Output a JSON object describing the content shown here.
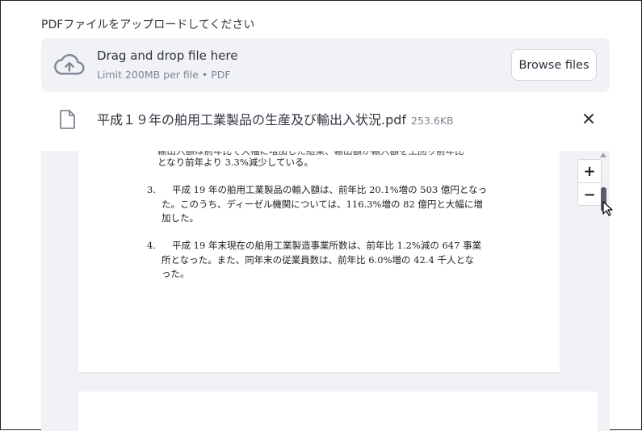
{
  "uploader": {
    "label": "PDFファイルをアップロードしてください",
    "dropzone_title": "Drag and drop file here",
    "dropzone_limit": "Limit 200MB per file • PDF",
    "browse_label": "Browse files"
  },
  "file": {
    "name": "平成１９年の舶用工業製品の生産及び輸出入状況.pdf",
    "size": "253.6KB"
  },
  "pdf": {
    "clipped_line": "輸出入額は前年比で大幅に増加した結果、輸出額が輸入額を上回り前年比",
    "lines": [
      {
        "num": "",
        "text": "となり前年より 3.3%減少している。"
      },
      {
        "num": "3.",
        "text": "平成 19 年の舶用工業製品の輸入額は、前年比 20.1%増の 503 億円となっ"
      },
      {
        "num": "",
        "text": "た。このうち、ディーゼル機関については、116.3%増の 82 億円と大幅に増"
      },
      {
        "num": "",
        "text": "加した。"
      },
      {
        "num": "4.",
        "text": "平成 19 年末現在の舶用工業製造事業所数は、前年比 1.2%減の 647 事業"
      },
      {
        "num": "",
        "text": "所となった。また、同年末の従業員数は、前年比 6.0%増の 42.4 千人とな"
      },
      {
        "num": "",
        "text": "った。"
      }
    ]
  },
  "zoom": {
    "plus": "+",
    "minus": "−"
  },
  "colors": {
    "accent": "#31333f",
    "muted": "#808495",
    "panel": "#f0f2f6"
  }
}
